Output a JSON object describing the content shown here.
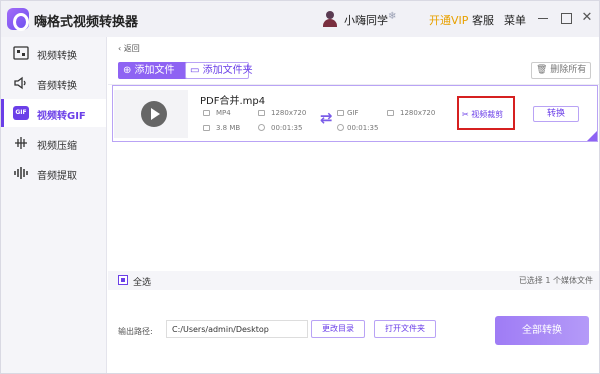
{
  "app": {
    "title": "嗨格式视频转换器",
    "username": "小嗨同学",
    "vip_label": "开通VIP",
    "service_label": "客服",
    "menu_label": "菜单",
    "close_glyph": "✕",
    "snow_glyph": "❄"
  },
  "sidebar": {
    "items": [
      {
        "label": "视频转换",
        "icon": "video-convert-icon",
        "active": false
      },
      {
        "label": "音频转换",
        "icon": "speaker-icon",
        "active": false
      },
      {
        "label": "视频转GIF",
        "icon": "gif-icon",
        "icon_text": "GIF",
        "active": true
      },
      {
        "label": "视频压缩",
        "icon": "compress-icon",
        "active": false
      },
      {
        "label": "音频提取",
        "icon": "audio-wave-icon",
        "active": false
      }
    ]
  },
  "main": {
    "back_label": "‹ 返回",
    "add_file_label": "⊕ 添加文件",
    "add_folder_label": "▭ 添加文件夹",
    "delete_all_label": "🗑 删除所有",
    "file": {
      "name": "PDF合并.mp4",
      "source_format": "MP4",
      "source_resolution": "1280x720",
      "source_size": "3.8 MB",
      "source_duration": "00:01:35",
      "target_format": "GIF",
      "target_resolution": "1280x720",
      "target_duration": "00:01:35",
      "crop_label": "✂ 视频裁剪",
      "convert_label": "转换"
    },
    "select_all_label": "全选",
    "selected_count_label": "已选择 1 个媒体文件",
    "output_label": "输出路径:",
    "output_path": "C:/Users/admin/Desktop",
    "change_dir_label": "更改目录",
    "open_folder_label": "打开文件夹",
    "convert_all_label": "全部转换"
  },
  "colors": {
    "accent": "#6b3fe8",
    "highlight_box": "#d62020",
    "vip": "#e8a100"
  }
}
